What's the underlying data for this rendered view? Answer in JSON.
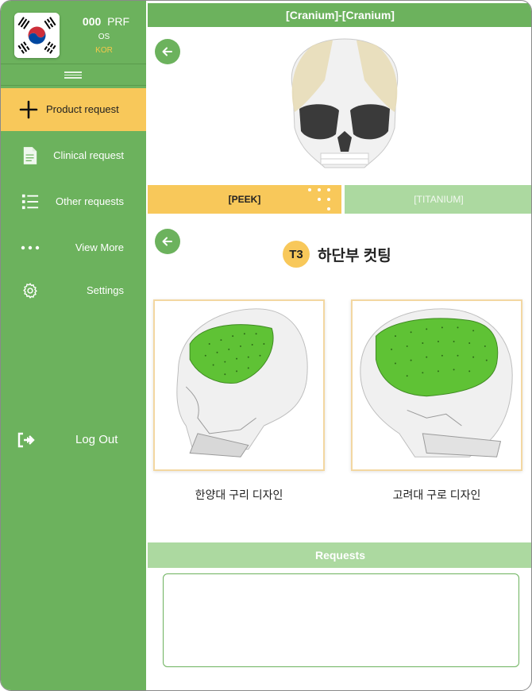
{
  "profile": {
    "code": "000",
    "type": "PRF",
    "role": "OS",
    "country": "KOR"
  },
  "nav": {
    "items": [
      {
        "label": "Product request",
        "icon": "plus-icon",
        "active": true
      },
      {
        "label": "Clinical request",
        "icon": "document-icon",
        "active": false
      },
      {
        "label": "Other requests",
        "icon": "list-icon",
        "active": false
      },
      {
        "label": "View More",
        "icon": "more-dots-icon",
        "active": false
      },
      {
        "label": "Settings",
        "icon": "gear-icon",
        "active": false
      }
    ],
    "logout_label": "Log Out"
  },
  "header": {
    "title": "[Cranium]-[Cranium]"
  },
  "tabs": [
    {
      "label": "[PEEK]",
      "active": true
    },
    {
      "label": "[TITANIUM]",
      "active": false
    }
  ],
  "step": {
    "badge": "T3",
    "title": "하단부 컷팅"
  },
  "options": [
    {
      "caption": "한양대 구리 디자인"
    },
    {
      "caption": "고려대 구로 디자인"
    }
  ],
  "requests": {
    "title": "Requests",
    "value": ""
  },
  "colors": {
    "primary_green": "#6cb25d",
    "light_green": "#acd9a0",
    "accent_yellow": "#f8c85a",
    "country_text": "#f5c84a",
    "implant_green": "#5fc235"
  }
}
